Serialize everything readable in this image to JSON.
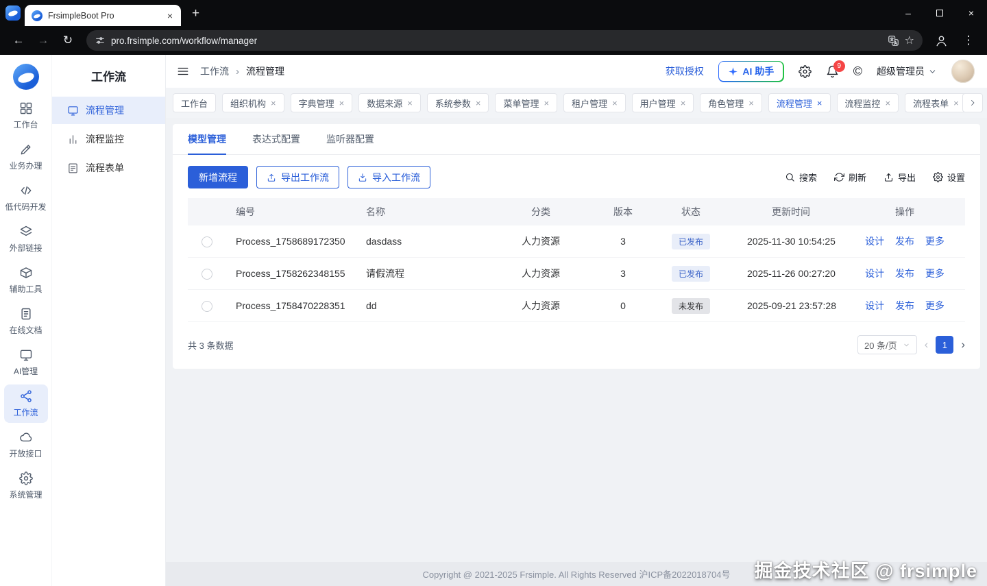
{
  "browser": {
    "tab_title": "FrsimpleBoot Pro",
    "url": "pro.frsimple.com/workflow/manager"
  },
  "icons": {
    "close": "×",
    "plus": "+",
    "minimize": "–",
    "back": "←",
    "forward": "→",
    "reload": "↻",
    "bookmark": "☆",
    "menu_dots": "⋮",
    "copyright_mark": "©",
    "crumb_sep": "›",
    "page_prev": "‹",
    "page_next": "›"
  },
  "colors": {
    "primary": "#2b5fd9",
    "badge_published_bg": "#e9eef9",
    "badge_published_text": "#3f66c9",
    "badge_unpublished_bg": "#e3e4e8",
    "badge_unpublished_text": "#303133",
    "notification_red": "#f54545"
  },
  "rail": {
    "items": [
      {
        "label": "工作台",
        "icon": "grid-icon",
        "active": false
      },
      {
        "label": "业务办理",
        "icon": "edit-icon",
        "active": false
      },
      {
        "label": "低代码开发",
        "icon": "code-icon",
        "active": false
      },
      {
        "label": "外部链接",
        "icon": "layers-icon",
        "active": false
      },
      {
        "label": "辅助工具",
        "icon": "toolbox-icon",
        "active": false
      },
      {
        "label": "在线文档",
        "icon": "document-icon",
        "active": false
      },
      {
        "label": "AI管理",
        "icon": "monitor-icon",
        "active": false
      },
      {
        "label": "工作流",
        "icon": "workflow-icon",
        "active": true
      },
      {
        "label": "开放接口",
        "icon": "cloud-icon",
        "active": false
      },
      {
        "label": "系统管理",
        "icon": "gear-icon",
        "active": false
      }
    ]
  },
  "sidebar": {
    "title": "工作流",
    "items": [
      {
        "label": "流程管理",
        "icon": "monitor-icon",
        "active": true
      },
      {
        "label": "流程监控",
        "icon": "chart-bars-icon",
        "active": false
      },
      {
        "label": "流程表单",
        "icon": "form-icon",
        "active": false
      }
    ]
  },
  "header": {
    "breadcrumb": {
      "root": "工作流",
      "current": "流程管理"
    },
    "license": "获取授权",
    "ai_assistant": "AI 助手",
    "badge_count": "9",
    "username": "超级管理员"
  },
  "tabbar": {
    "tabs": [
      {
        "label": "工作台",
        "closable": false,
        "active": false
      },
      {
        "label": "组织机构",
        "closable": true,
        "active": false
      },
      {
        "label": "字典管理",
        "closable": true,
        "active": false
      },
      {
        "label": "数据来源",
        "closable": true,
        "active": false
      },
      {
        "label": "系统参数",
        "closable": true,
        "active": false
      },
      {
        "label": "菜单管理",
        "closable": true,
        "active": false
      },
      {
        "label": "租户管理",
        "closable": true,
        "active": false
      },
      {
        "label": "用户管理",
        "closable": true,
        "active": false
      },
      {
        "label": "角色管理",
        "closable": true,
        "active": false
      },
      {
        "label": "流程管理",
        "closable": true,
        "active": true
      },
      {
        "label": "流程监控",
        "closable": true,
        "active": false
      },
      {
        "label": "流程表单",
        "closable": true,
        "active": false
      }
    ]
  },
  "panel": {
    "tabs": [
      {
        "label": "模型管理",
        "active": true
      },
      {
        "label": "表达式配置",
        "active": false
      },
      {
        "label": "监听器配置",
        "active": false
      }
    ],
    "actions": {
      "add": "新增流程",
      "export_flow": "导出工作流",
      "import_flow": "导入工作流"
    },
    "tools": [
      {
        "label": "搜索",
        "icon": "search-icon"
      },
      {
        "label": "刷新",
        "icon": "refresh-icon"
      },
      {
        "label": "导出",
        "icon": "export-icon"
      },
      {
        "label": "设置",
        "icon": "gear-icon"
      }
    ],
    "table": {
      "columns": [
        "编号",
        "名称",
        "分类",
        "版本",
        "状态",
        "更新时间",
        "操作"
      ],
      "row_actions": [
        "设计",
        "发布",
        "更多"
      ],
      "rows": [
        {
          "code": "Process_1758689172350",
          "name": "dasdass",
          "category": "人力资源",
          "version": "3",
          "status": "已发布",
          "published": true,
          "updated": "2025-11-30 10:54:25"
        },
        {
          "code": "Process_1758262348155",
          "name": "请假流程",
          "category": "人力资源",
          "version": "3",
          "status": "已发布",
          "published": true,
          "updated": "2025-11-26 00:27:20"
        },
        {
          "code": "Process_1758470228351",
          "name": "dd",
          "category": "人力资源",
          "version": "0",
          "status": "未发布",
          "published": false,
          "updated": "2025-09-21 23:57:28"
        }
      ]
    },
    "pagination": {
      "total": "共 3 条数据",
      "page_size": "20 条/页",
      "page": "1"
    }
  },
  "footer": {
    "copyright": "Copyright @ 2021-2025 Frsimple. All Rights Reserved 沪ICP备2022018704号"
  },
  "watermark": "掘金技术社区 @ frsimple"
}
